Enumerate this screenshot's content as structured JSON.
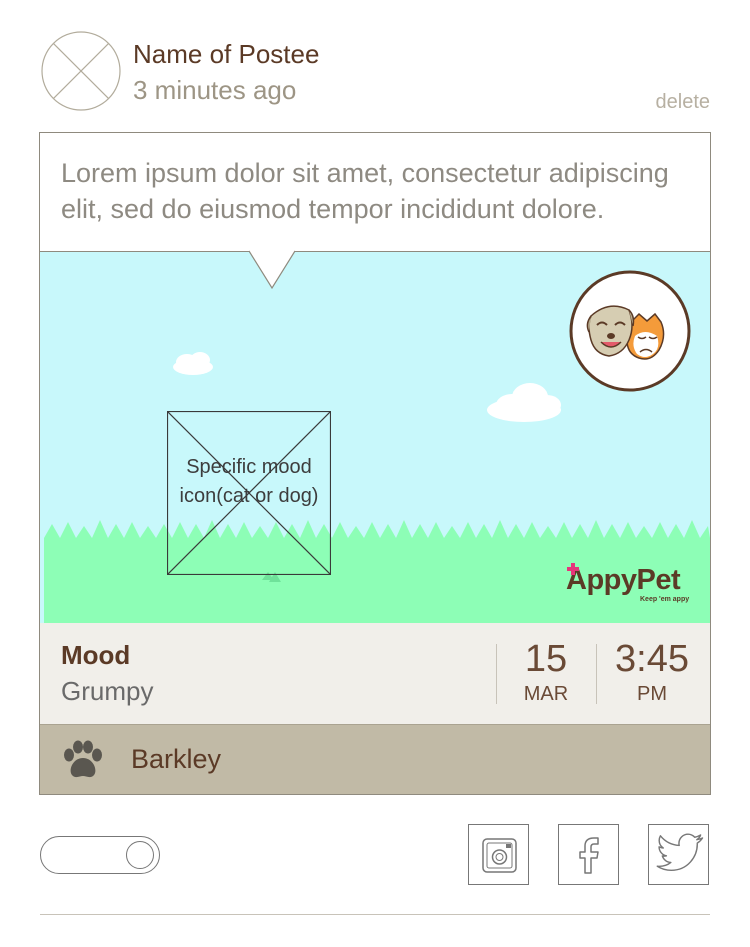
{
  "post": {
    "poster_name": "Name of Postee",
    "time_ago": "3 minutes ago",
    "delete_label": "delete",
    "caption": "Lorem ipsum dolor sit amet, consectetur adipiscing elit, sed do eiusmod tempor incididunt dolore."
  },
  "scene": {
    "mood_icon_placeholder": "Specific mood icon(cat or dog)",
    "badge_icon": "cat-dog-masks-icon",
    "brand": {
      "name": "AppyPet",
      "tagline": "Keep 'em appy"
    }
  },
  "info": {
    "mood_title": "Mood",
    "mood_value": "Grumpy",
    "day": "15",
    "month": "MAR",
    "time": "3:45",
    "ampm": "PM"
  },
  "pet": {
    "icon": "paw-icon",
    "name": "Barkley"
  },
  "footer": {
    "toggle_state": "off",
    "share_icons": [
      "instagram-icon",
      "facebook-icon",
      "twitter-icon"
    ]
  },
  "colors": {
    "primary_text": "#5b3a26",
    "sky": "#c8f8fb",
    "grass": "#8dfeb6",
    "info_bg": "#f1efea",
    "pet_bar": "#c1baa6",
    "brand_accent": "#e6357b"
  }
}
